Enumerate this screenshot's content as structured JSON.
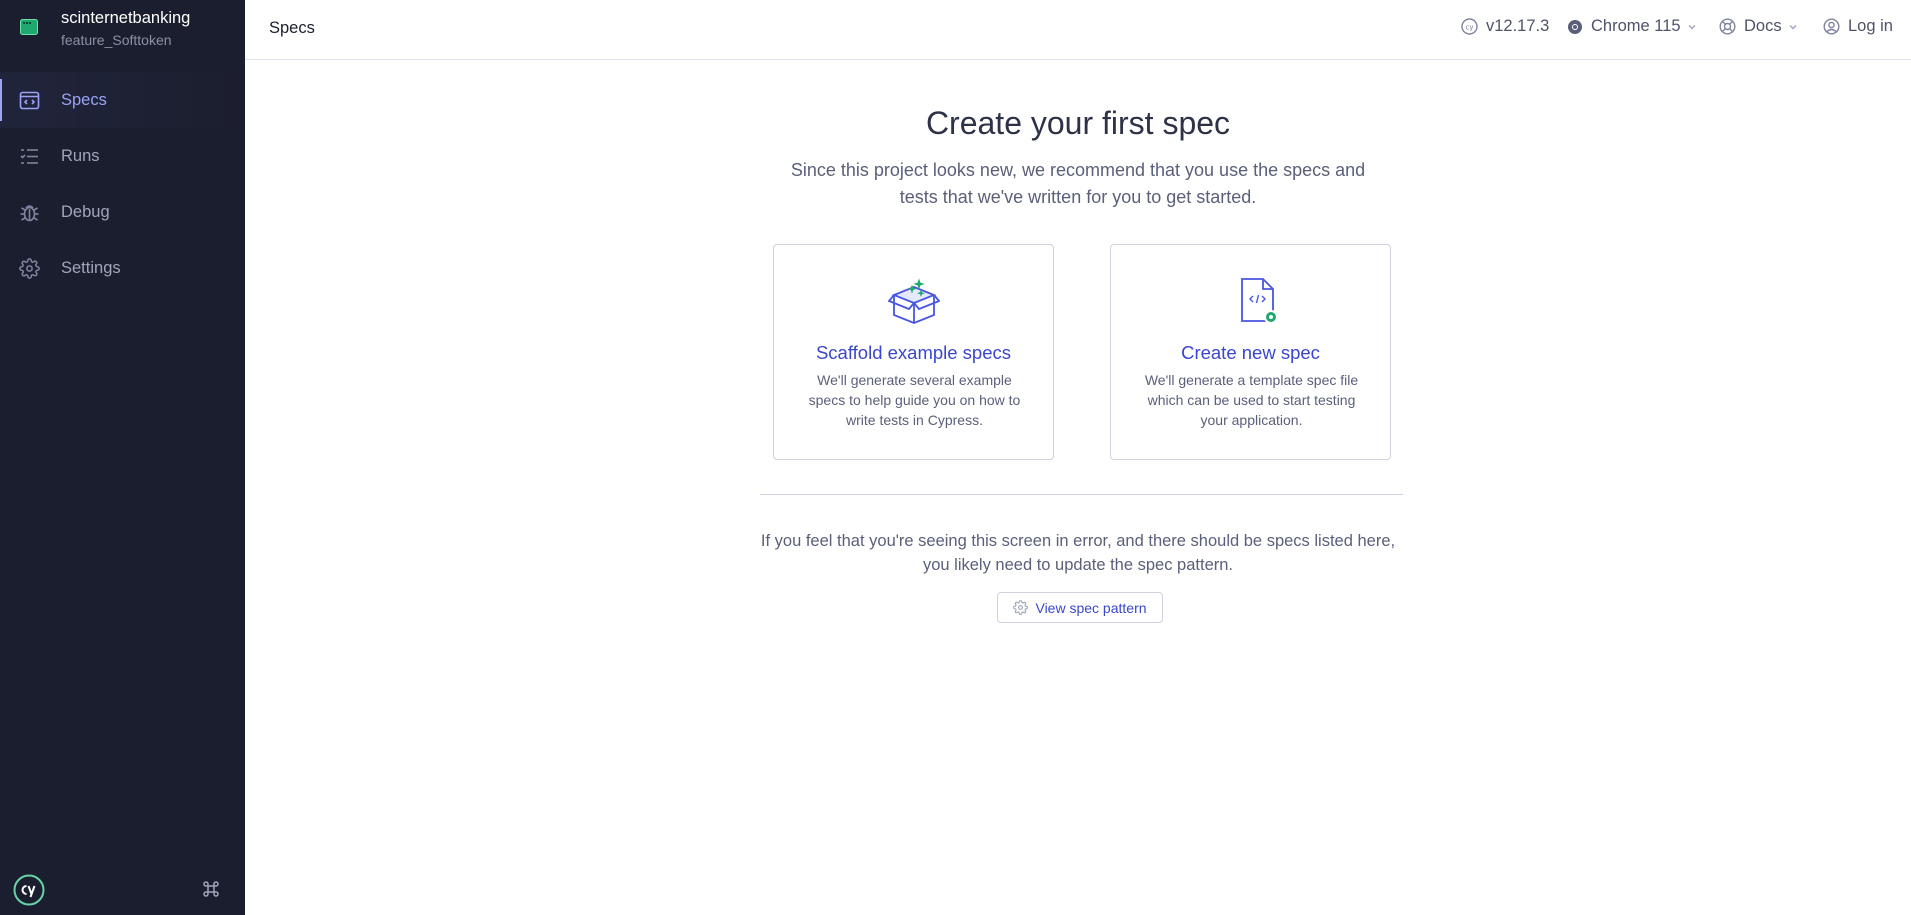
{
  "project": {
    "name": "scinternetbanking",
    "branch": "feature_Softtoken"
  },
  "sidebar": {
    "items": [
      {
        "label": "Specs",
        "icon": "specs-icon",
        "active": true
      },
      {
        "label": "Runs",
        "icon": "runs-icon",
        "active": false
      },
      {
        "label": "Debug",
        "icon": "debug-icon",
        "active": false
      },
      {
        "label": "Settings",
        "icon": "settings-icon",
        "active": false
      }
    ]
  },
  "header": {
    "title": "Specs",
    "version": "v12.17.3",
    "browser": "Chrome 115",
    "docs": "Docs",
    "login": "Log in"
  },
  "main": {
    "title": "Create your first spec",
    "subtitle": "Since this project looks new, we recommend that you use the specs and tests that we've written for you to get started.",
    "cards": [
      {
        "title": "Scaffold example specs",
        "description": "We'll generate several example specs to help guide you on how to write tests in Cypress."
      },
      {
        "title": "Create new spec",
        "description": "We'll generate a template spec file which can be used to start testing your application."
      }
    ],
    "error_text_line1": "If you feel that you're seeing this screen in error, and there should be specs listed here,",
    "error_text_line2": "you likely need to update the spec pattern.",
    "view_spec_pattern": "View spec pattern"
  },
  "colors": {
    "sidebar_bg": "#1b1e2e",
    "accent": "#3a46cc",
    "active_nav": "#9ba3f4",
    "success": "#1fa971"
  }
}
